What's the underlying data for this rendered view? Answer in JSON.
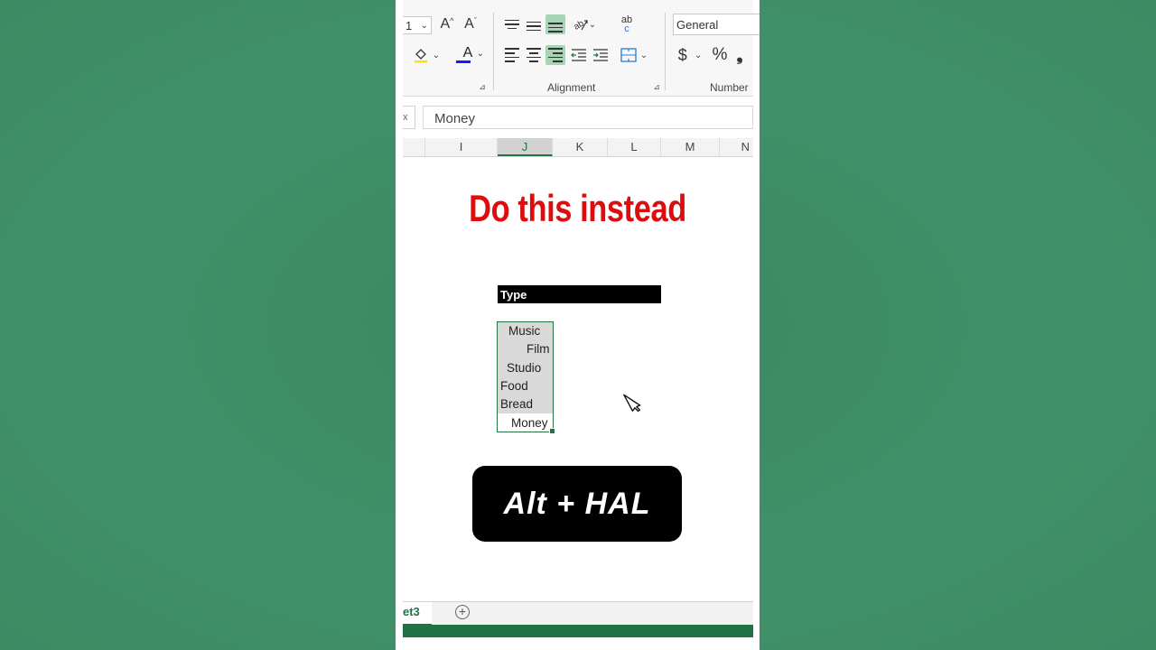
{
  "ribbon": {
    "font_size_value": "1",
    "grow_font_label": "A",
    "shrink_font_label": "A",
    "font_color_label": "A",
    "alignment_group_label": "Alignment",
    "number_group_label": "Number",
    "number_format_value": "General",
    "currency_symbol": "$",
    "percent_symbol": "%",
    "comma_symbol": "❟",
    "wrap_text_glyph": "ab",
    "wrap_text_glyph2": "c"
  },
  "formula_bar": {
    "fx_label": "x",
    "value": "Money"
  },
  "columns": [
    "I",
    "J",
    "K",
    "L",
    "M",
    "N"
  ],
  "headline": "Do this instead",
  "sheet": {
    "header_cell": "Type",
    "cells": [
      "Music",
      "Film",
      "Studio",
      "Food",
      "Bread",
      "Money"
    ]
  },
  "shortcut": "Alt + HAL",
  "tabs": {
    "active_sheet": "et3",
    "add_sheet_symbol": "+"
  },
  "colors": {
    "background": "#3f8c62",
    "headline": "#dd0d0d",
    "excel_green": "#217346",
    "active_button": "#a9d3b5"
  }
}
